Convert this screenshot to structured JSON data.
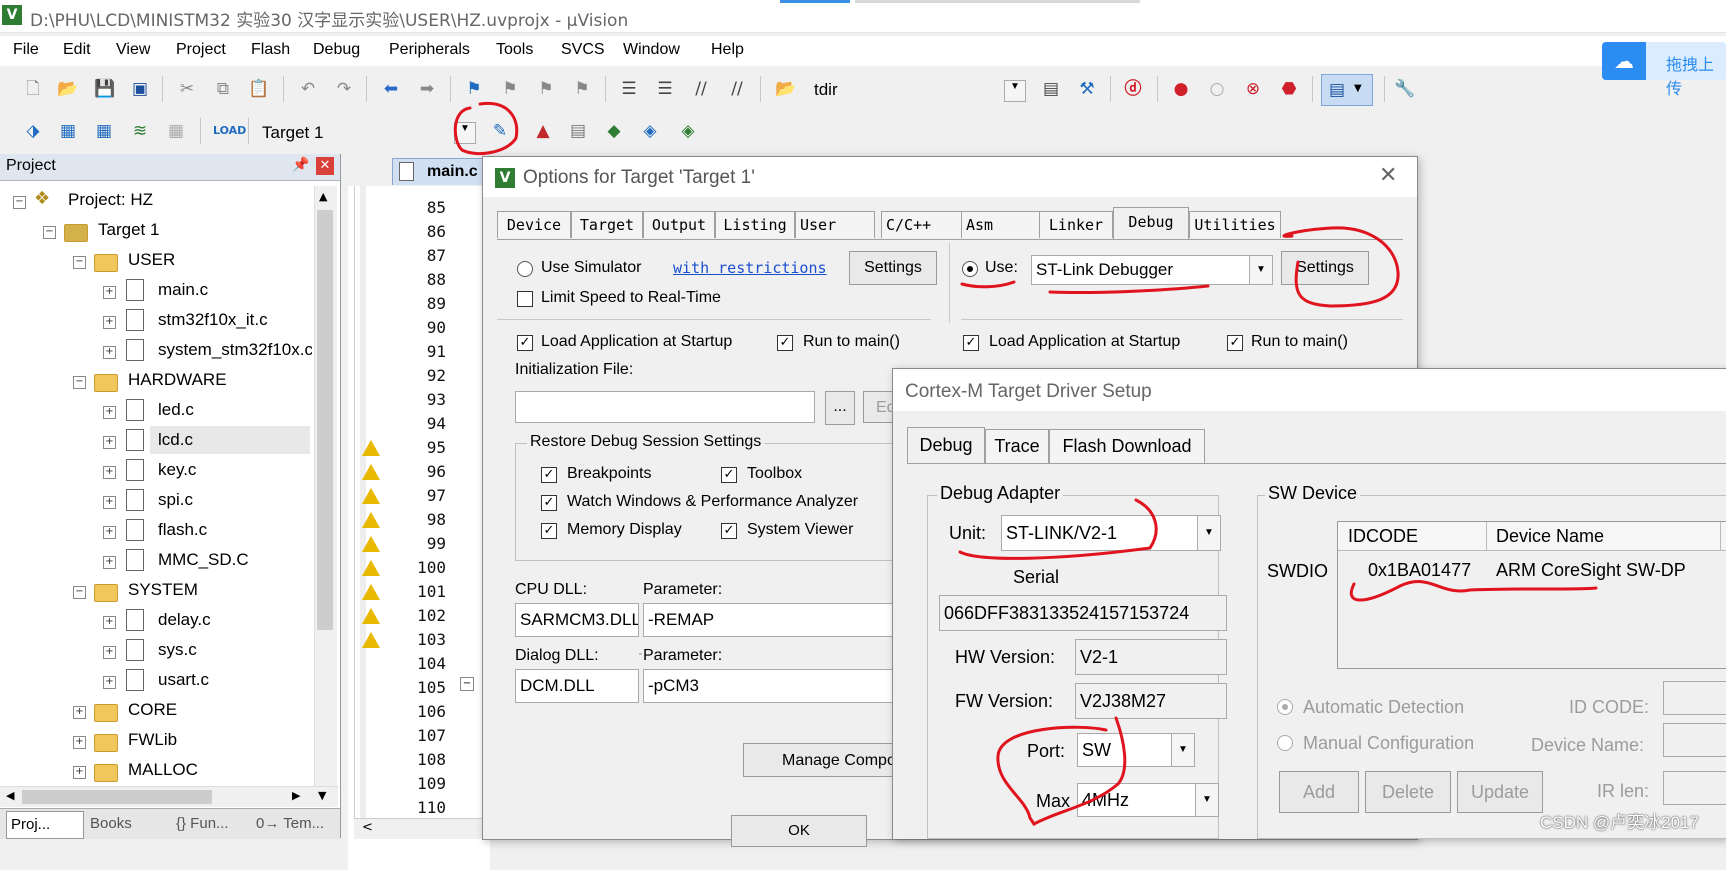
{
  "window": {
    "title": "D:\\PHU\\LCD\\MINISTM32 实验30 汉字显示实验\\USER\\HZ.uvprojx - µVision",
    "app_icon": "uvision-logo"
  },
  "menu": [
    "File",
    "Edit",
    "View",
    "Project",
    "Flash",
    "Debug",
    "Peripherals",
    "Tools",
    "SVCS",
    "Window",
    "Help"
  ],
  "cloud_button": {
    "label": "拖拽上传",
    "icon": "baidu-cloud-icon",
    "color": "#2b8cf2"
  },
  "toolbar1": {
    "find_text": "tdir"
  },
  "toolbar2": {
    "target_select": "Target 1"
  },
  "project_panel": {
    "title": "Project",
    "tree": [
      {
        "label": "Project: HZ"
      },
      {
        "label": "Target 1"
      },
      {
        "label": "USER"
      },
      {
        "label": "main.c"
      },
      {
        "label": "stm32f10x_it.c"
      },
      {
        "label": "system_stm32f10x.c"
      },
      {
        "label": "HARDWARE"
      },
      {
        "label": "led.c"
      },
      {
        "label": "lcd.c"
      },
      {
        "label": "key.c"
      },
      {
        "label": "spi.c"
      },
      {
        "label": "flash.c"
      },
      {
        "label": "MMC_SD.C"
      },
      {
        "label": "SYSTEM"
      },
      {
        "label": "delay.c"
      },
      {
        "label": "sys.c"
      },
      {
        "label": "usart.c"
      },
      {
        "label": "CORE"
      },
      {
        "label": "FWLib"
      },
      {
        "label": "MALLOC"
      }
    ],
    "bottom_tabs": [
      "Proj...",
      "Books",
      "{} Fun...",
      "0→ Tem..."
    ]
  },
  "editor": {
    "tab": "main.c",
    "line_numbers": [
      "85",
      "86",
      "87",
      "88",
      "89",
      "90",
      "91",
      "92",
      "93",
      "94",
      "95",
      "96",
      "97",
      "98",
      "99",
      "100",
      "101",
      "102",
      "103",
      "104",
      "105",
      "106",
      "107",
      "108",
      "109",
      "110"
    ],
    "warning_lines": [
      "95",
      "96",
      "97",
      "98",
      "99",
      "100",
      "101",
      "102",
      "103"
    ]
  },
  "options_dialog": {
    "title": "Options for Target 'Target 1'",
    "tabs": [
      "Device",
      "Target",
      "Output",
      "Listing",
      "User",
      "C/C++",
      "Asm",
      "Linker",
      "Debug",
      "Utilities"
    ],
    "active_tab": "Debug",
    "left": {
      "use_simulator": "Use Simulator",
      "restrictions_link": "with restrictions",
      "settings": "Settings",
      "limit_speed": "Limit Speed to Real-Time",
      "load_app": "Load Application at Startup",
      "run_to_main": "Run to main()",
      "init_file_label": "Initialization File:",
      "browse": "...",
      "edit": "Ed",
      "restore_group": "Restore Debug Session Settings",
      "breakpoints": "Breakpoints",
      "toolbox": "Toolbox",
      "watch_windows": "Watch Windows & Performance Analyzer",
      "memory_display": "Memory Display",
      "system_viewer": "System Viewer",
      "cpu_dll_label": "CPU DLL:",
      "cpu_param_label": "Parameter:",
      "cpu_dll": "SARMCM3.DLL",
      "cpu_param": "-REMAP",
      "dialog_dll_label": "Dialog DLL:",
      "dialog_param_label": "Parameter:",
      "dialog_dll": "DCM.DLL",
      "dialog_param": "-pCM3",
      "manage": "Manage Compo"
    },
    "right": {
      "use_label": "Use:",
      "debugger": "ST-Link Debugger",
      "settings": "Settings",
      "load_app": "Load Application at Startup",
      "run_to_main": "Run to main()"
    },
    "ok": "OK"
  },
  "cortex_dialog": {
    "title": "Cortex-M Target Driver Setup",
    "tabs": [
      "Debug",
      "Trace",
      "Flash Download"
    ],
    "debug_adapter": {
      "group": "Debug Adapter",
      "unit_label": "Unit:",
      "unit": "ST-LINK/V2-1",
      "serial_label": "Serial",
      "serial": "066DFF383133524157153724",
      "hw_label": "HW Version:",
      "hw": "V2-1",
      "fw_label": "FW Version:",
      "fw": "V2J38M27",
      "port_label": "Port:",
      "port": "SW",
      "max_label": "Max",
      "max": "4MHz"
    },
    "sw_device": {
      "group": "SW Device",
      "columns": [
        "IDCODE",
        "Device Name"
      ],
      "row_label": "SWDIO",
      "rows": [
        {
          "idcode": "0x1BA01477",
          "name": "ARM CoreSight SW-DP"
        }
      ],
      "auto_detect": "Automatic Detection",
      "manual_config": "Manual Configuration",
      "id_code_label": "ID CODE:",
      "device_name_label": "Device Name:",
      "ir_len_label": "IR len:",
      "add": "Add",
      "delete": "Delete",
      "update": "Update"
    }
  },
  "watermark": "CSDN @卢奕冰2017",
  "annotation_color": "#e0141e"
}
